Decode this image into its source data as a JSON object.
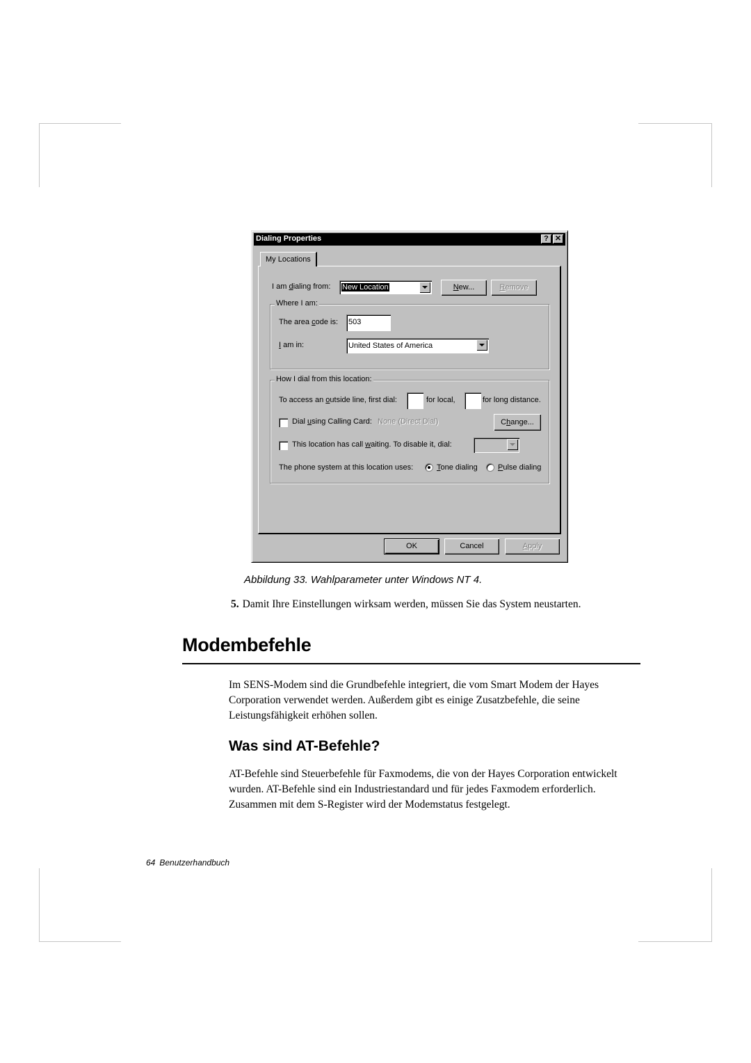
{
  "dialog": {
    "title": "Dialing Properties",
    "help_button": "?",
    "close_button": "✕",
    "tab_label": "My Locations",
    "dialing_from": {
      "label_pre": "I am ",
      "label_accel": "d",
      "label_post": "ialing from:",
      "value": "New Location",
      "new_button_accel": "N",
      "new_button_rest": "ew...",
      "remove_button_accel": "R",
      "remove_button_rest": "emove"
    },
    "where_group": {
      "title": "Where I am:",
      "area_code_label_pre": "The area ",
      "area_code_label_accel": "c",
      "area_code_label_post": "ode is:",
      "area_code_value": "503",
      "country_label_accel": "I",
      "country_label_post": " am in:",
      "country_value": "United States of America"
    },
    "how_group": {
      "title": "How I dial from this location:",
      "outside_label_pre": "To access an ",
      "outside_label_accel": "o",
      "outside_label_post": "utside line, first dial:",
      "local_value": "",
      "for_local": "for local,",
      "long_distance_value": "",
      "for_long_distance": "for long distance.",
      "calling_card_checked": false,
      "calling_card_label_pre": "Dial ",
      "calling_card_label_accel": "u",
      "calling_card_label_post": "sing Calling Card:",
      "calling_card_value": "None (Direct Dial)",
      "change_button_pre": "C",
      "change_button_accel": "h",
      "change_button_post": "ange...",
      "call_waiting_checked": false,
      "call_waiting_label_pre": "This location has call ",
      "call_waiting_label_accel": "w",
      "call_waiting_label_post": "aiting. To disable it, dial:",
      "call_waiting_value": "",
      "phone_system_label": "The phone system at this location uses:",
      "tone_accel": "T",
      "tone_rest": "one dialing",
      "pulse_accel": "P",
      "pulse_rest": "ulse dialing",
      "selected_dialing": "tone"
    },
    "ok_button": "OK",
    "cancel_button": "Cancel",
    "apply_button_accel": "A",
    "apply_button_rest": "pply"
  },
  "document": {
    "caption": "Abbildung 33.  Wahlparameter unter Windows NT 4.",
    "step_number": "5.",
    "step_text": "Damit Ihre Einstellungen wirksam werden, müssen Sie das System neustarten.",
    "heading1": "Modembefehle",
    "paragraph1": "Im SENS-Modem sind die Grundbefehle integriert, die vom Smart Modem der Hayes Corporation verwendet werden. Außerdem gibt es einige Zusatzbefehle, die seine Leistungsfähigkeit erhöhen sollen.",
    "heading2": "Was sind AT-Befehle?",
    "paragraph2": "AT-Befehle sind Steuerbefehle für Faxmodems, die von der Hayes Corporation entwickelt wurden. AT-Befehle sind ein Industriestandard und für jedes Faxmodem erforderlich. Zusammen mit dem S-Register wird der Modemstatus festgelegt.",
    "footer_page": "64",
    "footer_title": "Benutzerhandbuch"
  }
}
